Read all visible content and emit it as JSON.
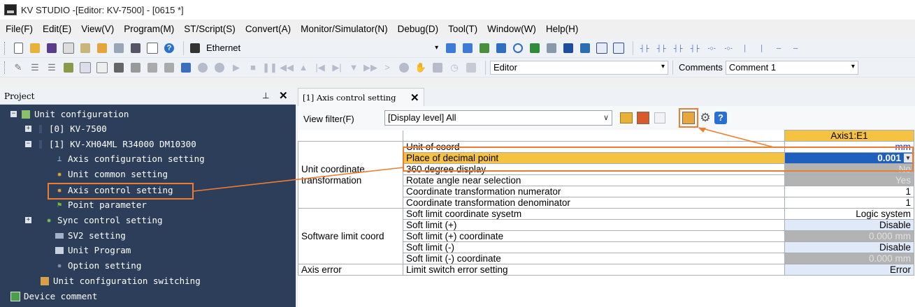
{
  "window": {
    "title": "KV STUDIO -[Editor: KV-7500] - [0615 *]"
  },
  "menu": [
    "File(F)",
    "Edit(E)",
    "View(V)",
    "Program(M)",
    "ST/Script(S)",
    "Convert(A)",
    "Monitor/Simulator(N)",
    "Debug(D)",
    "Tool(T)",
    "Window(W)",
    "Help(H)"
  ],
  "toolbar1": {
    "connection": "Ethernet"
  },
  "toolbar2": {
    "mode": "Editor",
    "comments_label": "Comments",
    "comment_value": "Comment 1"
  },
  "project": {
    "title": "Project",
    "items": [
      {
        "label": "Unit configuration"
      },
      {
        "label": "[0]  KV-7500"
      },
      {
        "label": "[1]  KV-XH04ML   R34000  DM10300"
      },
      {
        "label": "Axis configuration setting"
      },
      {
        "label": "Unit common setting"
      },
      {
        "label": "Axis control setting"
      },
      {
        "label": "Point parameter"
      },
      {
        "label": "Sync control setting"
      },
      {
        "label": "SV2 setting"
      },
      {
        "label": "Unit Program"
      },
      {
        "label": "Option setting"
      },
      {
        "label": "Unit configuration switching"
      },
      {
        "label": "Device comment"
      }
    ]
  },
  "editor": {
    "tab_label": "[1] Axis control setting",
    "view_filter_label": "View filter(F)",
    "view_filter_value": "[Display level] All",
    "axis_header": "Axis1:E1",
    "groups": [
      {
        "name": "Unit coordinate transformation"
      },
      {
        "name": "Software limit coord"
      },
      {
        "name": "Axis error"
      }
    ],
    "params": [
      {
        "label": "Unit of coord",
        "value": "mm"
      },
      {
        "label": "Place of decimal point",
        "value": "0.001"
      },
      {
        "label": "360 degree display",
        "value": "No"
      },
      {
        "label": "Rotate angle near selection",
        "value": "Yes"
      },
      {
        "label": "Coordinate transformation numerator",
        "value": "1"
      },
      {
        "label": "Coordinate transformation denominator",
        "value": "1"
      },
      {
        "label": "Soft limit coordinate sysetm",
        "value": "Logic system"
      },
      {
        "label": "Soft limit (+)",
        "value": "Disable"
      },
      {
        "label": "Soft limit (+) coordinate",
        "value": "0.000 mm"
      },
      {
        "label": "Soft limit (-)",
        "value": "Disable"
      },
      {
        "label": "Soft limit (-) coordinate",
        "value": "0.000 mm"
      },
      {
        "label": "Limit switch error setting",
        "value": "Error"
      }
    ]
  },
  "colors": {
    "tree_bg": "#2d3e5b",
    "highlight": "#ef7d31",
    "axis_header": "#f5c242",
    "selected": "#1f5fbd"
  }
}
